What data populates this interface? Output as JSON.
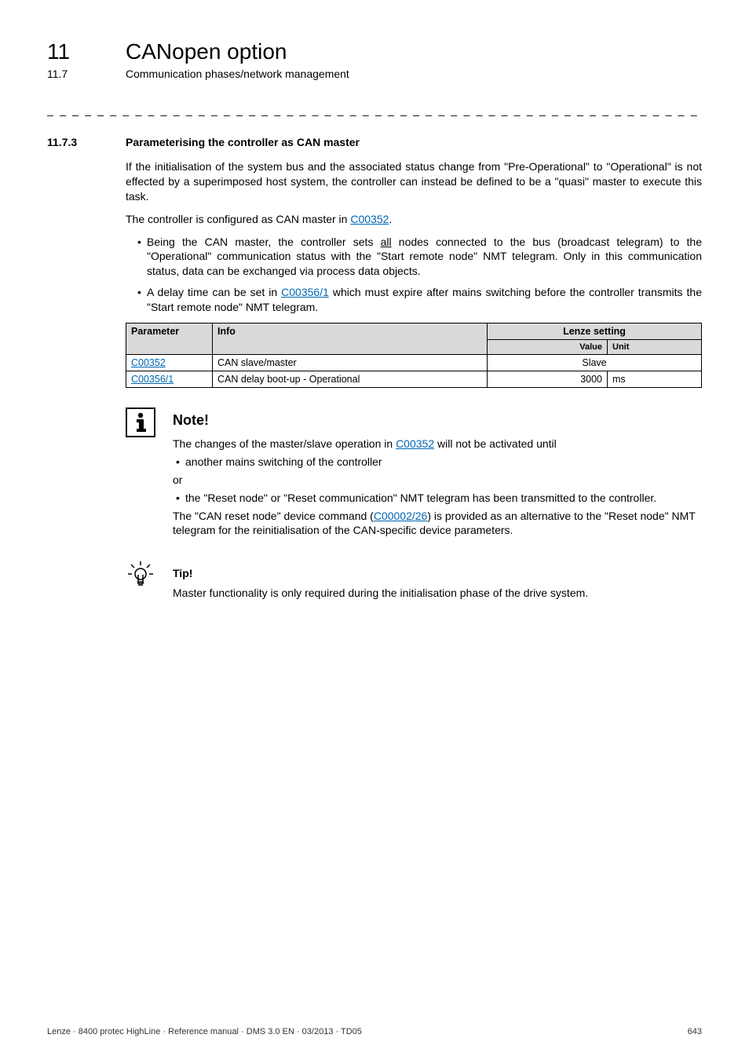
{
  "header": {
    "chapter_num": "11",
    "chapter_title": "CANopen option",
    "sub_num": "11.7",
    "sub_title": "Communication phases/network management"
  },
  "section": {
    "num": "11.7.3",
    "title": "Parameterising the controller as CAN master"
  },
  "para1": "If the initialisation of the system bus and the associated status change from \"Pre-Operational\" to \"Operational\" is not effected by a superimposed host system, the controller can instead be defined to be a \"quasi\" master to execute this task.",
  "para2_pre": "The controller is configured as CAN master in ",
  "para2_link": "C00352",
  "para2_post": ".",
  "bullet1_pre": "Being the CAN master, the controller sets ",
  "bullet1_under": "all",
  "bullet1_post": " nodes connected to the bus (broadcast telegram) to the \"Operational\" communication status with the \"Start remote node\" NMT telegram. Only in this communication status, data can be exchanged via process data objects.",
  "bullet2_pre": "A delay time can be set in ",
  "bullet2_link": "C00356/1",
  "bullet2_post": " which must expire after mains switching before the controller transmits the \"Start remote node\" NMT telegram.",
  "table": {
    "headers": {
      "parameter": "Parameter",
      "info": "Info",
      "lenze": "Lenze setting",
      "value": "Value",
      "unit": "Unit"
    },
    "rows": [
      {
        "param": "C00352",
        "info": "CAN slave/master",
        "value": "Slave",
        "unit": ""
      },
      {
        "param": "C00356/1",
        "info": "CAN delay boot-up - Operational",
        "value": "3000",
        "unit": "ms"
      }
    ]
  },
  "note": {
    "title": "Note!",
    "p1_pre": "The changes of the master/slave operation in ",
    "p1_link": "C00352",
    "p1_post": " will not be activated until",
    "li1": "another mains switching of the controller",
    "or": "or",
    "li2": "the \"Reset node\" or \"Reset communication\" NMT telegram has been transmitted to the controller.",
    "p2_pre": "The \"CAN reset node\" device command (",
    "p2_link": "C00002/26",
    "p2_post": ") is provided as an alternative to the \"Reset node\" NMT telegram for the reinitialisation of the CAN-specific device parameters."
  },
  "tip": {
    "title": "Tip!",
    "body": "Master functionality is only required during the initialisation phase of the drive system."
  },
  "footer": {
    "left": "Lenze · 8400 protec HighLine · Reference manual · DMS 3.0 EN · 03/2013 · TD05",
    "right": "643"
  },
  "chart_data": null
}
